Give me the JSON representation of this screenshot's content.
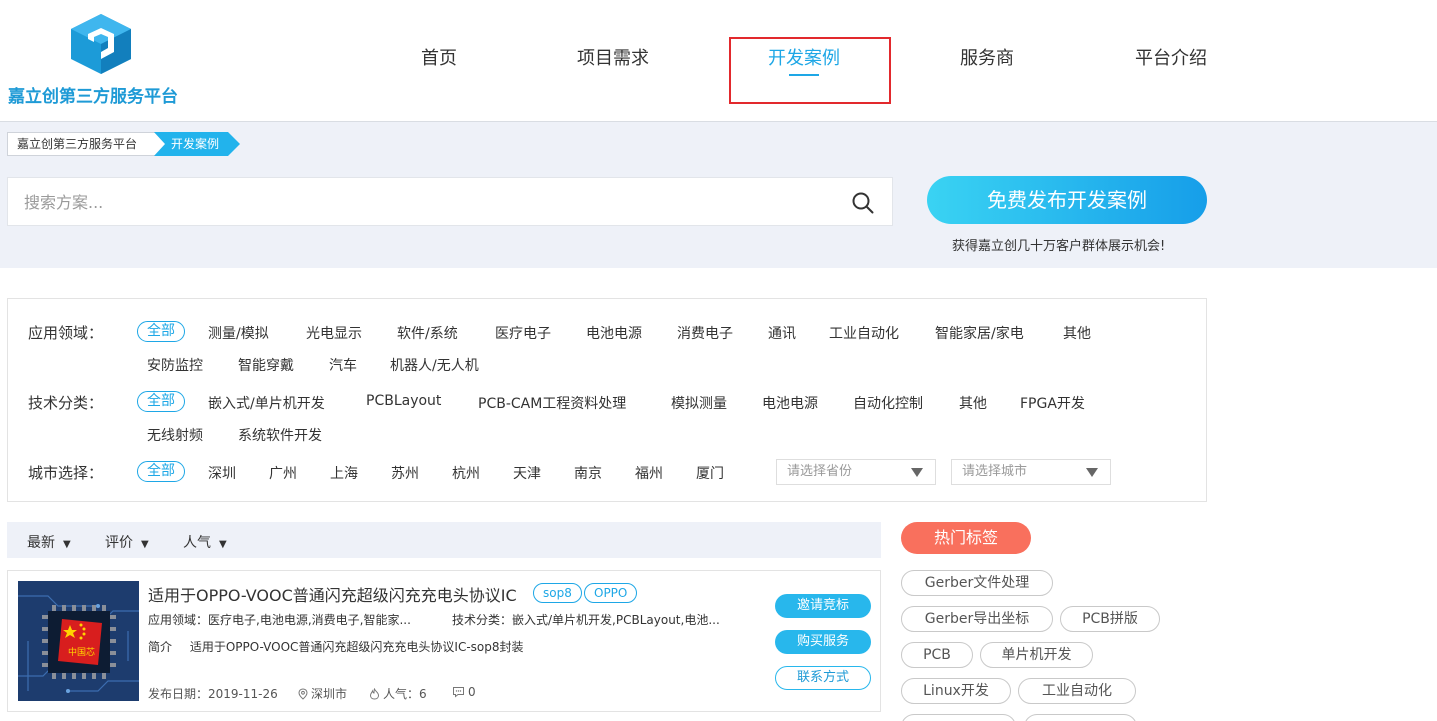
{
  "header": {
    "logo_text": "嘉立创第三方服务平台",
    "nav": [
      {
        "label": "首页"
      },
      {
        "label": "项目需求"
      },
      {
        "label": "开发案例"
      },
      {
        "label": "服务商"
      },
      {
        "label": "平台介绍"
      }
    ],
    "active_nav": "开发案例"
  },
  "breadcrumb": {
    "home": "嘉立创第三方服务平台",
    "current": "开发案例"
  },
  "search": {
    "placeholder": "搜索方案...",
    "value": ""
  },
  "publish": {
    "button_label": "免费发布开发案例",
    "subtitle": "获得嘉立创几十万客户群体展示机会!"
  },
  "filters": {
    "domain": {
      "label": "应用领域：",
      "options": [
        "全部",
        "测量/模拟",
        "光电显示",
        "软件/系统",
        "医疗电子",
        "电池电源",
        "消费电子",
        "通讯",
        "工业自动化",
        "智能家居/家电",
        "其他",
        "安防监控",
        "智能穿戴",
        "汽车",
        "机器人/无人机"
      ],
      "selected": "全部"
    },
    "tech": {
      "label": "技术分类：",
      "options": [
        "全部",
        "嵌入式/单片机开发",
        "PCBLayout",
        "PCB-CAM工程资料处理",
        "模拟测量",
        "电池电源",
        "自动化控制",
        "其他",
        "FPGA开发",
        "无线射频",
        "系统软件开发"
      ],
      "selected": "全部"
    },
    "city": {
      "label": "城市选择：",
      "options": [
        "全部",
        "深圳",
        "广州",
        "上海",
        "苏州",
        "杭州",
        "天津",
        "南京",
        "福州",
        "厦门"
      ],
      "selected": "全部",
      "province_placeholder": "请选择省份",
      "city_placeholder": "请选择城市"
    }
  },
  "sort": {
    "items": [
      "最新",
      "评价",
      "人气"
    ]
  },
  "case": {
    "title": "适用于OPPO-VOOC普通闪充超级闪充充电头协议IC",
    "tags": [
      "sop8",
      "OPPO"
    ],
    "domain_label": "应用领域：",
    "domain_value": "医疗电子,电池电源,消费电子,智能家...",
    "tech_label": "技术分类：",
    "tech_value": "嵌入式/单片机开发,PCBLayout,电池...",
    "intro_label": "简介",
    "intro_value": "适用于OPPO-VOOC普通闪充超级闪充充电头协议IC-sop8封装",
    "date_label": "发布日期：",
    "date_value": "2019-11-26",
    "location": "深圳市",
    "popularity_label": "人气：",
    "popularity_value": "6",
    "comments": "0",
    "thumb_text": "中国芯",
    "actions": [
      "邀请竞标",
      "购买服务",
      "联系方式"
    ]
  },
  "hot_tags": {
    "title": "热门标签",
    "tags": [
      "Gerber文件处理",
      "Gerber导出坐标",
      "PCB拼版",
      "PCB",
      "单片机开发",
      "Linux开发",
      "工业自动化"
    ]
  },
  "colors": {
    "accent": "#1ea7e6",
    "hot": "#f9705d",
    "highlight_box": "#e2292d"
  }
}
